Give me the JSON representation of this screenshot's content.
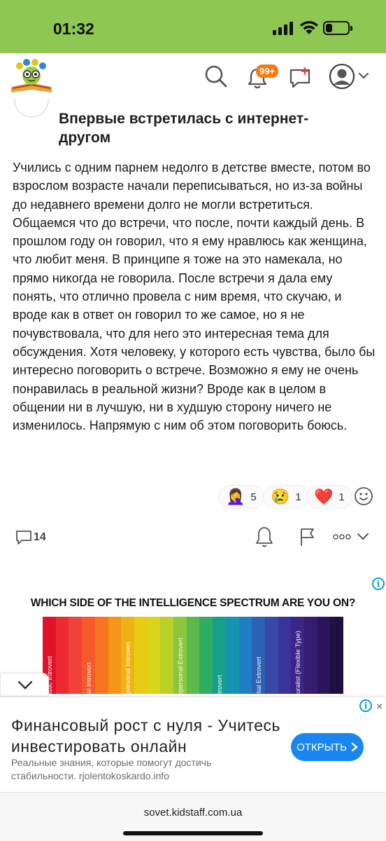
{
  "status": {
    "time": "01:32",
    "battery_level": 0.3
  },
  "header": {
    "logo": "kidstaff-logo",
    "notifications_badge": "99+",
    "new_post_badge": "+"
  },
  "post": {
    "title": "Впервые встретилась с интернет-другом",
    "body": "Учились с одним парнем недолго в детстве вместе, потом во взрослом возрасте начали переписываться, но из-за войны до недавнего времени долго не могли встретиться. Общаемся что до встречи, что после, почти каждый день. В прошлом году он говорил, что я ему нравлюсь как женщина, что любит меня. В принципе я тоже на это намекала, но прямо никогда не говорила. После встречи я дала ему понять, что отлично провела с ним время, что скучаю, и вроде как в ответ он говорил то же самое, но я не почувствовала, что для него это интересная тема для обсуждения. Хотя человеку, у которого есть чувства, было бы интересно поговорить о встрече. Возможно я ему не очень понравилась в реальной жизни? Вроде как в целом в общении ни в лучшую, ни в худшую сторону ничего не изменилось. Напрямую с ним об этом поговорить боюсь.",
    "reactions": [
      {
        "emoji": "🤦‍♀️",
        "count": "5"
      },
      {
        "emoji": "😢",
        "count": "1"
      },
      {
        "emoji": "❤️",
        "count": "1"
      }
    ],
    "comments_count": "14"
  },
  "ad_spectrum": {
    "title": "WHICH SIDE OF THE INTELLIGENCE SPECTRUM ARE YOU ON?",
    "colors": [
      "#e0132b",
      "#ec2a33",
      "#f2403a",
      "#f65a2b",
      "#f6761f",
      "#f39516",
      "#efb214",
      "#e8cc14",
      "#d8d51a",
      "#b9d22a",
      "#8cc63c",
      "#5db94a",
      "#2fae63",
      "#15a08a",
      "#1792b0",
      "#1e7fc4",
      "#2b62b5",
      "#3848a6",
      "#3b329a",
      "#3b2585",
      "#361c70",
      "#2b1558",
      "#1f0f42"
    ],
    "labels": [
      "istic Introvert",
      "al Introvert",
      "personal Introvert",
      "rpersonal Extrovert",
      "trovert",
      "tial Extrovert",
      "uralist (Flexible Type)"
    ]
  },
  "ad_bottom": {
    "title": "Финансовый рост с нуля - Учитесь инвестировать онлайн",
    "description": "Реальные знания, которые помогут достичь стабильности. rjolentokoskardo.info",
    "button_label": "ОТКРЫТЬ",
    "info_symbol": "i",
    "close_symbol": "×"
  },
  "browser": {
    "url": "sovet.kidstaff.com.ua"
  }
}
